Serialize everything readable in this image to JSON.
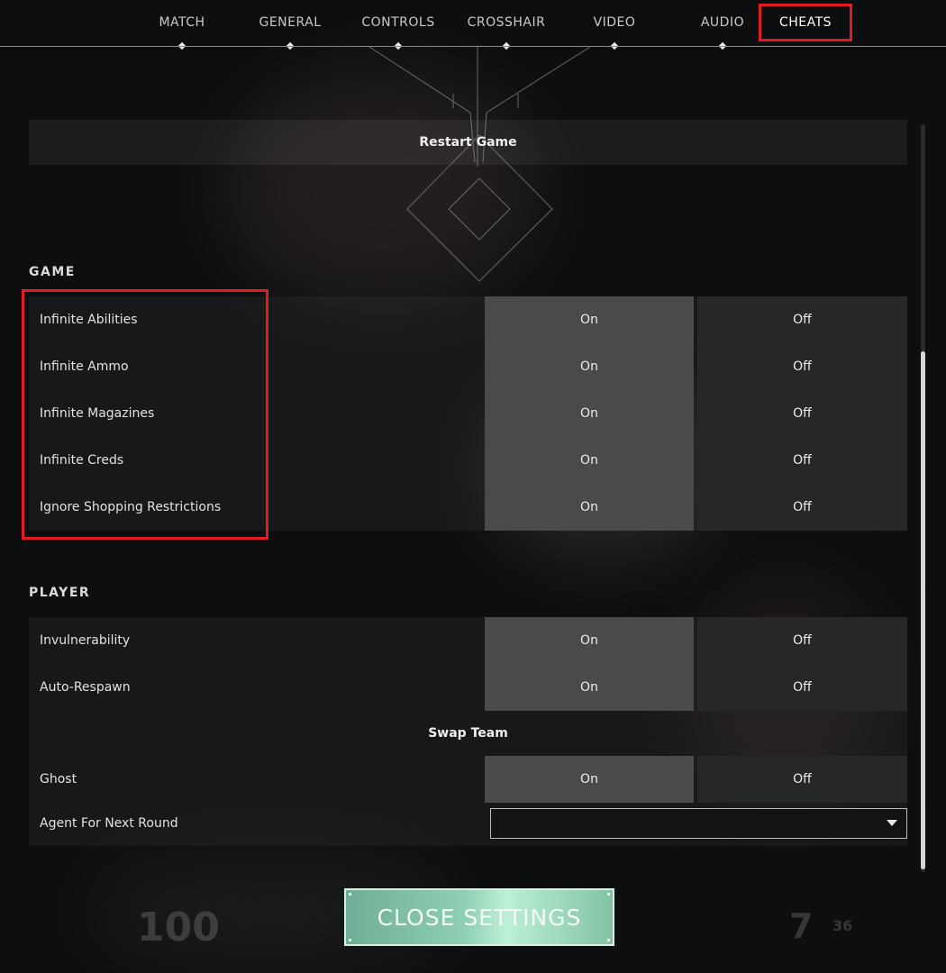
{
  "nav": {
    "tabs": [
      {
        "label": "MATCH"
      },
      {
        "label": "GENERAL"
      },
      {
        "label": "CONTROLS"
      },
      {
        "label": "CROSSHAIR"
      },
      {
        "label": "VIDEO"
      },
      {
        "label": "AUDIO"
      },
      {
        "label": "CHEATS"
      }
    ],
    "active": "CHEATS"
  },
  "restart_label": "Restart Game",
  "game": {
    "title": "GAME",
    "rows": [
      {
        "label": "Infinite Abilities",
        "on": "On",
        "off": "Off"
      },
      {
        "label": "Infinite Ammo",
        "on": "On",
        "off": "Off"
      },
      {
        "label": "Infinite Magazines",
        "on": "On",
        "off": "Off"
      },
      {
        "label": "Infinite Creds",
        "on": "On",
        "off": "Off"
      },
      {
        "label": "Ignore Shopping Restrictions",
        "on": "On",
        "off": "Off"
      }
    ]
  },
  "player": {
    "title": "PLAYER",
    "rows": [
      {
        "label": "Invulnerability",
        "on": "On",
        "off": "Off"
      },
      {
        "label": "Auto-Respawn",
        "on": "On",
        "off": "Off"
      }
    ],
    "swap_label": "Swap Team",
    "ghost": {
      "label": "Ghost",
      "on": "On",
      "off": "Off"
    },
    "agent": {
      "label": "Agent For Next Round",
      "value": ""
    }
  },
  "close_label": "CLOSE SETTINGS",
  "hud": {
    "left": "100",
    "right": "7",
    "right_small": "36"
  },
  "colors": {
    "highlight": "#e11b22",
    "selected_option": "#4a4a4a",
    "close_button": "#8fd0b4"
  }
}
